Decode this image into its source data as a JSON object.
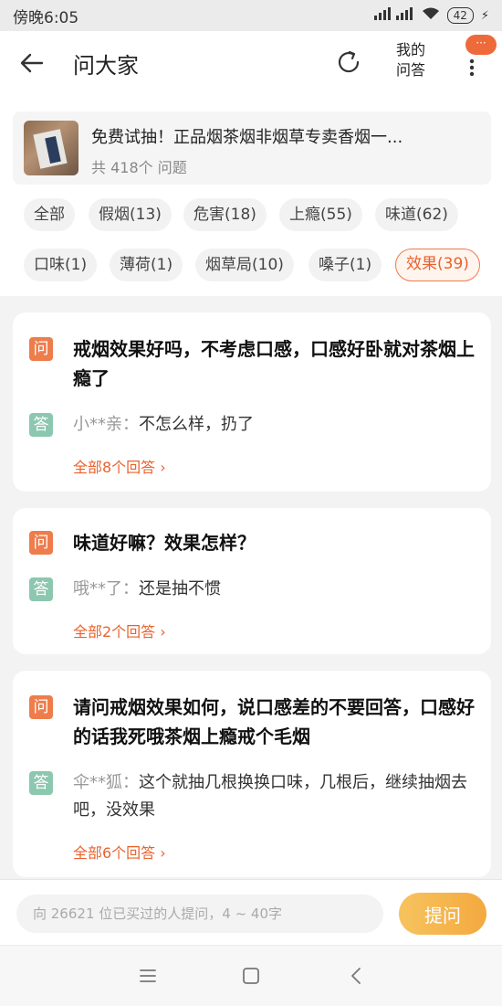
{
  "status_bar": {
    "time": "傍晚6:05",
    "battery": "42",
    "signal_labels": [
      "HD",
      "HD"
    ]
  },
  "header": {
    "title": "问大家",
    "my_qa": "我的\n问答",
    "badge": "···"
  },
  "product": {
    "title": "免费试抽！正品烟茶烟非烟草专卖香烟一...",
    "count": "共 418个 问题"
  },
  "tags": [
    {
      "label": "全部",
      "active": false
    },
    {
      "label": "假烟(13)",
      "active": false
    },
    {
      "label": "危害(18)",
      "active": false
    },
    {
      "label": "上瘾(55)",
      "active": false
    },
    {
      "label": "味道(62)",
      "active": false
    },
    {
      "label": "口味(1)",
      "active": false
    },
    {
      "label": "薄荷(1)",
      "active": false
    },
    {
      "label": "烟草局(10)",
      "active": false
    },
    {
      "label": "嗓子(1)",
      "active": false
    },
    {
      "label": "效果(39)",
      "active": true
    }
  ],
  "questions": [
    {
      "q_badge": "问",
      "question": "戒烟效果好吗，不考虑口感，口感好卧就对茶烟上瘾了",
      "a_badge": "答",
      "answer_user": "小**亲：",
      "answer": "不怎么样，扔了",
      "all_answers": "全部8个回答"
    },
    {
      "q_badge": "问",
      "question": "味道好嘛？效果怎样？",
      "a_badge": "答",
      "answer_user": "哦**了：",
      "answer": "还是抽不惯",
      "all_answers": "全部2个回答"
    },
    {
      "q_badge": "问",
      "question": "请问戒烟效果如何，说口感差的不要回答，口感好的话我死哦茶烟上瘾戒个毛烟",
      "a_badge": "答",
      "answer_user": "伞**狐：",
      "answer": "这个就抽几根换换口味，几根后，继续抽烟去吧，没效果",
      "all_answers": "全部6个回答"
    }
  ],
  "bottom": {
    "placeholder": "向 26621 位已买过的人提问，4 ~ 40字",
    "ask_button": "提问"
  },
  "colors": {
    "accent": "#e9622d",
    "question_badge": "#ee7d4c",
    "answer_badge": "#8cc7b0",
    "ask_button": "#f4a93e"
  },
  "icons": [
    "back-arrow-icon",
    "refresh-icon",
    "more-dots-icon",
    "menu-icon",
    "home-icon",
    "back-nav-icon",
    "chevron-right-icon"
  ]
}
